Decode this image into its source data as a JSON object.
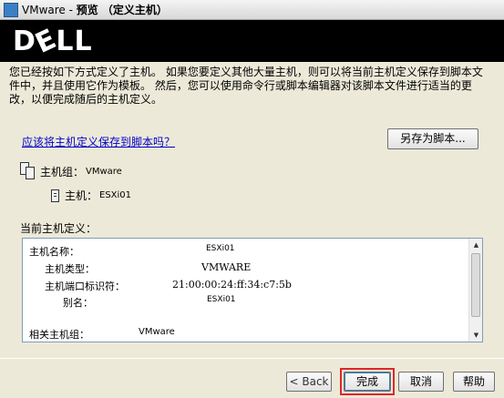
{
  "window": {
    "title_prefix": "VMware  - ",
    "title_main": "预览 （定义主机）"
  },
  "banner": {
    "logo": "DELL"
  },
  "intro": "您已经按如下方式定义了主机。  如果您要定义其他大量主机，则可以将当前主机定义保存到脚本文件中，并且使用它作为模板。 然后，您可以使用命令行或脚本编辑器对该脚本文件进行适当的更改，以便完成随后的主机定义。",
  "save_link": "应该将主机定义保存到脚本吗？",
  "save_script_button": "另存为脚本...",
  "tree": {
    "host_group_key": "主机组：",
    "host_group_value": "VMware",
    "host_key": "主机：",
    "host_value": "ESXi01"
  },
  "definition": {
    "label": "当前主机定义：",
    "rows": [
      {
        "key": "主机名称：",
        "value": "ESXi01"
      },
      {
        "key": "主机类型：",
        "value": "VMWARE"
      },
      {
        "key": "主机端口标识符：",
        "value": "21:00:00:24:ff:34:c7:5b"
      },
      {
        "key": "别名：",
        "value": "ESXi01"
      },
      {
        "key": "相关主机组：",
        "value": "VMware"
      }
    ]
  },
  "footer": {
    "back": "< Back",
    "finish": "完成",
    "cancel": "取消",
    "help": "帮助"
  },
  "colors": {
    "highlight": "#e0262a",
    "link": "#0000cc"
  }
}
